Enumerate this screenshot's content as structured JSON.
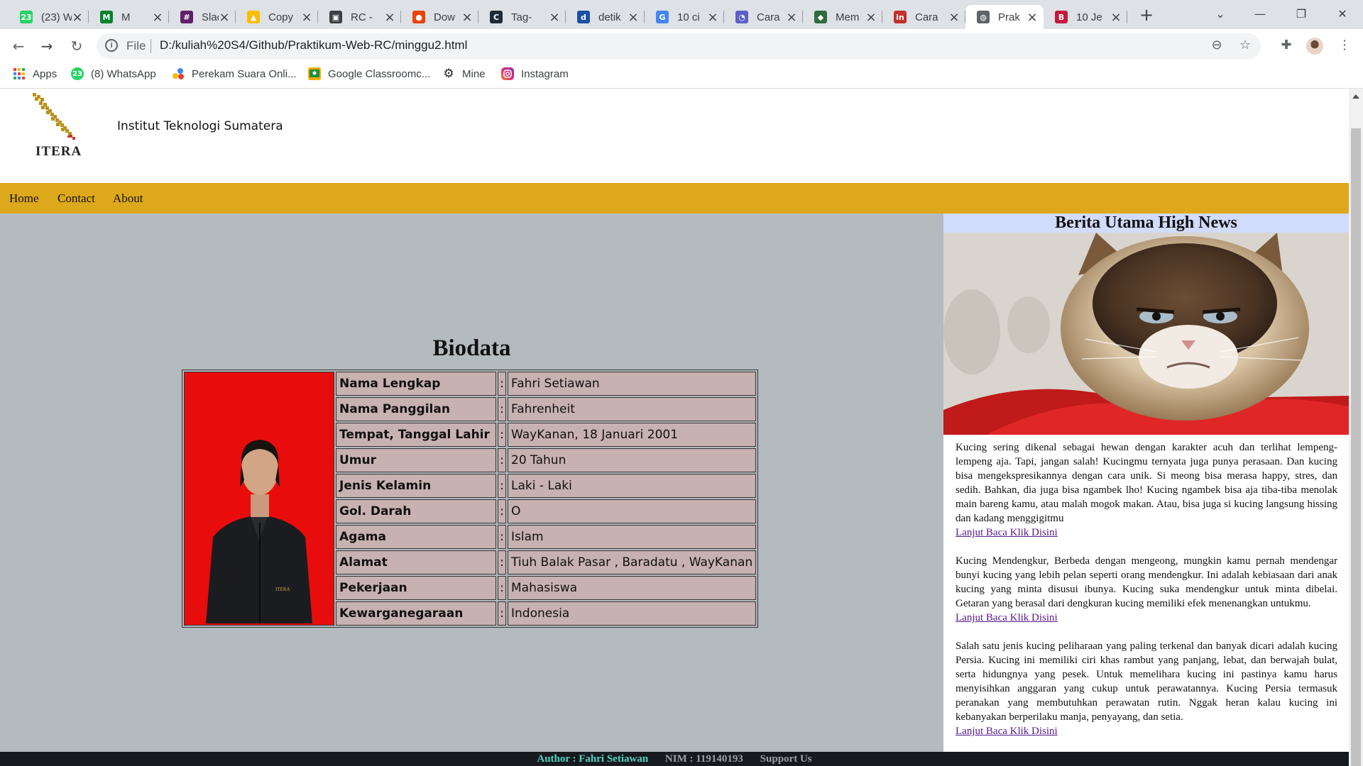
{
  "browser": {
    "tabs": [
      {
        "title": "(23) W",
        "icon": "whatsapp-icon",
        "color": "#25d366",
        "glyph": "23"
      },
      {
        "title": "M",
        "icon": "google-meet-icon",
        "color": "#00832d",
        "glyph": "M"
      },
      {
        "title": "Slack",
        "icon": "slack-icon",
        "color": "#611f69",
        "glyph": "#"
      },
      {
        "title": "Copy",
        "icon": "google-drive-icon",
        "color": "#fbbc04",
        "glyph": "▲"
      },
      {
        "title": "RC -",
        "icon": "classroom-icon",
        "color": "#3c4043",
        "glyph": "▣"
      },
      {
        "title": "Dow",
        "icon": "download-icon",
        "color": "#e8430a",
        "glyph": "●"
      },
      {
        "title": "Tag-",
        "icon": "codepen-icon",
        "color": "#1e2a37",
        "glyph": "C"
      },
      {
        "title": "detik",
        "icon": "detik-icon",
        "color": "#1d4fa5",
        "glyph": "d"
      },
      {
        "title": "10 ci",
        "icon": "google-icon",
        "color": "#4285f4",
        "glyph": "G"
      },
      {
        "title": "Cara",
        "icon": "teams-icon",
        "color": "#5b5fc7",
        "glyph": "◔"
      },
      {
        "title": "Mem",
        "icon": "cube-icon",
        "color": "#2f6b3f",
        "glyph": "◆"
      },
      {
        "title": "Cara",
        "icon": "linkedin-icon",
        "color": "#c4302b",
        "glyph": "in"
      },
      {
        "title": "Prak",
        "icon": "globe-icon",
        "color": "#5f6368",
        "glyph": "◍",
        "active": true
      },
      {
        "title": "10 Je",
        "icon": "bootstrap-icon",
        "color": "#c4183c",
        "glyph": "B"
      }
    ],
    "omnibox": {
      "scheme": "File",
      "url": "D:/kuliah%20S4/Github/Praktikum-Web-RC/minggu2.html"
    },
    "bookmarks": [
      {
        "label": "Apps",
        "icon": "apps-grid-icon"
      },
      {
        "label": "(8) WhatsApp",
        "icon": "whatsapp-icon",
        "badge": "23"
      },
      {
        "label": "Perekam Suara Onli...",
        "icon": "recorder-icon"
      },
      {
        "label": "Google Classroomc...",
        "icon": "classroom-icon"
      },
      {
        "label": "Mine",
        "icon": "gear-icon"
      },
      {
        "label": "Instagram",
        "icon": "instagram-icon"
      }
    ]
  },
  "site": {
    "logo_text": "ITERA",
    "institution": "Institut Teknologi Sumatera",
    "nav": [
      "Home",
      "Contact",
      "About"
    ],
    "biodata_title": "Biodata",
    "photo_badge": "ITERA",
    "biodata": [
      {
        "label": "Nama Lengkap",
        "sep": ":",
        "value": "Fahri Setiawan"
      },
      {
        "label": "Nama Panggilan",
        "sep": ":",
        "value": "Fahrenheit"
      },
      {
        "label": "Tempat, Tanggal Lahir",
        "sep": ":",
        "value": "WayKanan, 18 Januari 2001"
      },
      {
        "label": "Umur",
        "sep": ":",
        "value": "20 Tahun"
      },
      {
        "label": "Jenis Kelamin",
        "sep": ":",
        "value": "Laki - Laki"
      },
      {
        "label": "Gol. Darah",
        "sep": ":",
        "value": "O"
      },
      {
        "label": "Agama",
        "sep": ":",
        "value": "Islam"
      },
      {
        "label": "Alamat",
        "sep": ":",
        "value": "Tiuh Balak Pasar , Baradatu , WayKanan"
      },
      {
        "label": "Pekerjaan",
        "sep": ":",
        "value": "Mahasiswa"
      },
      {
        "label": "Kewarganegaraan",
        "sep": ":",
        "value": "Indonesia"
      }
    ],
    "news": {
      "title": "Berita Utama High News",
      "articles": [
        {
          "text": "Kucing sering dikenal sebagai hewan dengan karakter acuh dan terlihat lempeng-lempeng aja. Tapi, jangan salah! Kucingmu ternyata juga punya perasaan. Dan kucing bisa mengekspresikannya dengan cara unik. Si meong bisa merasa happy, stres, dan sedih. Bahkan, dia juga bisa ngambek lho! Kucing ngambek bisa aja tiba-tiba menolak main bareng kamu, atau malah mogok makan. Atau, bisa juga si kucing langsung hissing dan kadang menggigitmu",
          "link": "Lanjut Baca Klik Disini"
        },
        {
          "text": "Kucing Mendengkur, Berbeda dengan mengeong, mungkin kamu pernah mendengar bunyi kucing yang lebih pelan seperti orang mendengkur. Ini adalah kebiasaan dari anak kucing yang minta disusui ibunya. Kucing suka mendengkur untuk minta dibelai. Getaran yang berasal dari dengkuran kucing memiliki efek menenangkan untukmu.",
          "link": "Lanjut Baca Klik Disini"
        },
        {
          "text": "Salah satu jenis kucing peliharaan yang paling terkenal dan banyak dicari adalah kucing Persia. Kucing ini memiliki ciri khas rambut yang panjang, lebat, dan berwajah bulat, serta hidungnya yang pesek. Untuk memelihara kucing ini pastinya kamu harus menyisihkan anggaran yang cukup untuk perawatannya. Kucing Persia termasuk peranakan yang membutuhkan perawatan rutin. Nggak heran kalau kucing ini kebanyakan berperilaku manja, penyayang, dan setia.",
          "link": "Lanjut Baca Klik Disini"
        }
      ]
    },
    "footer": {
      "author": "Author : Fahri Setiawan",
      "nim": "NIM : 119140193",
      "support": "Support Us"
    }
  },
  "colors": {
    "navbar": "#dda81b",
    "main_bg": "#b4bbbf",
    "table_cell": "#c8b1b1",
    "photo_bg": "#e90c0c",
    "news_title_bg": "#d1dbfb",
    "footer_bg": "#16191d",
    "footer_author": "#4fd3c4",
    "footer_muted": "#9aa0a6"
  }
}
